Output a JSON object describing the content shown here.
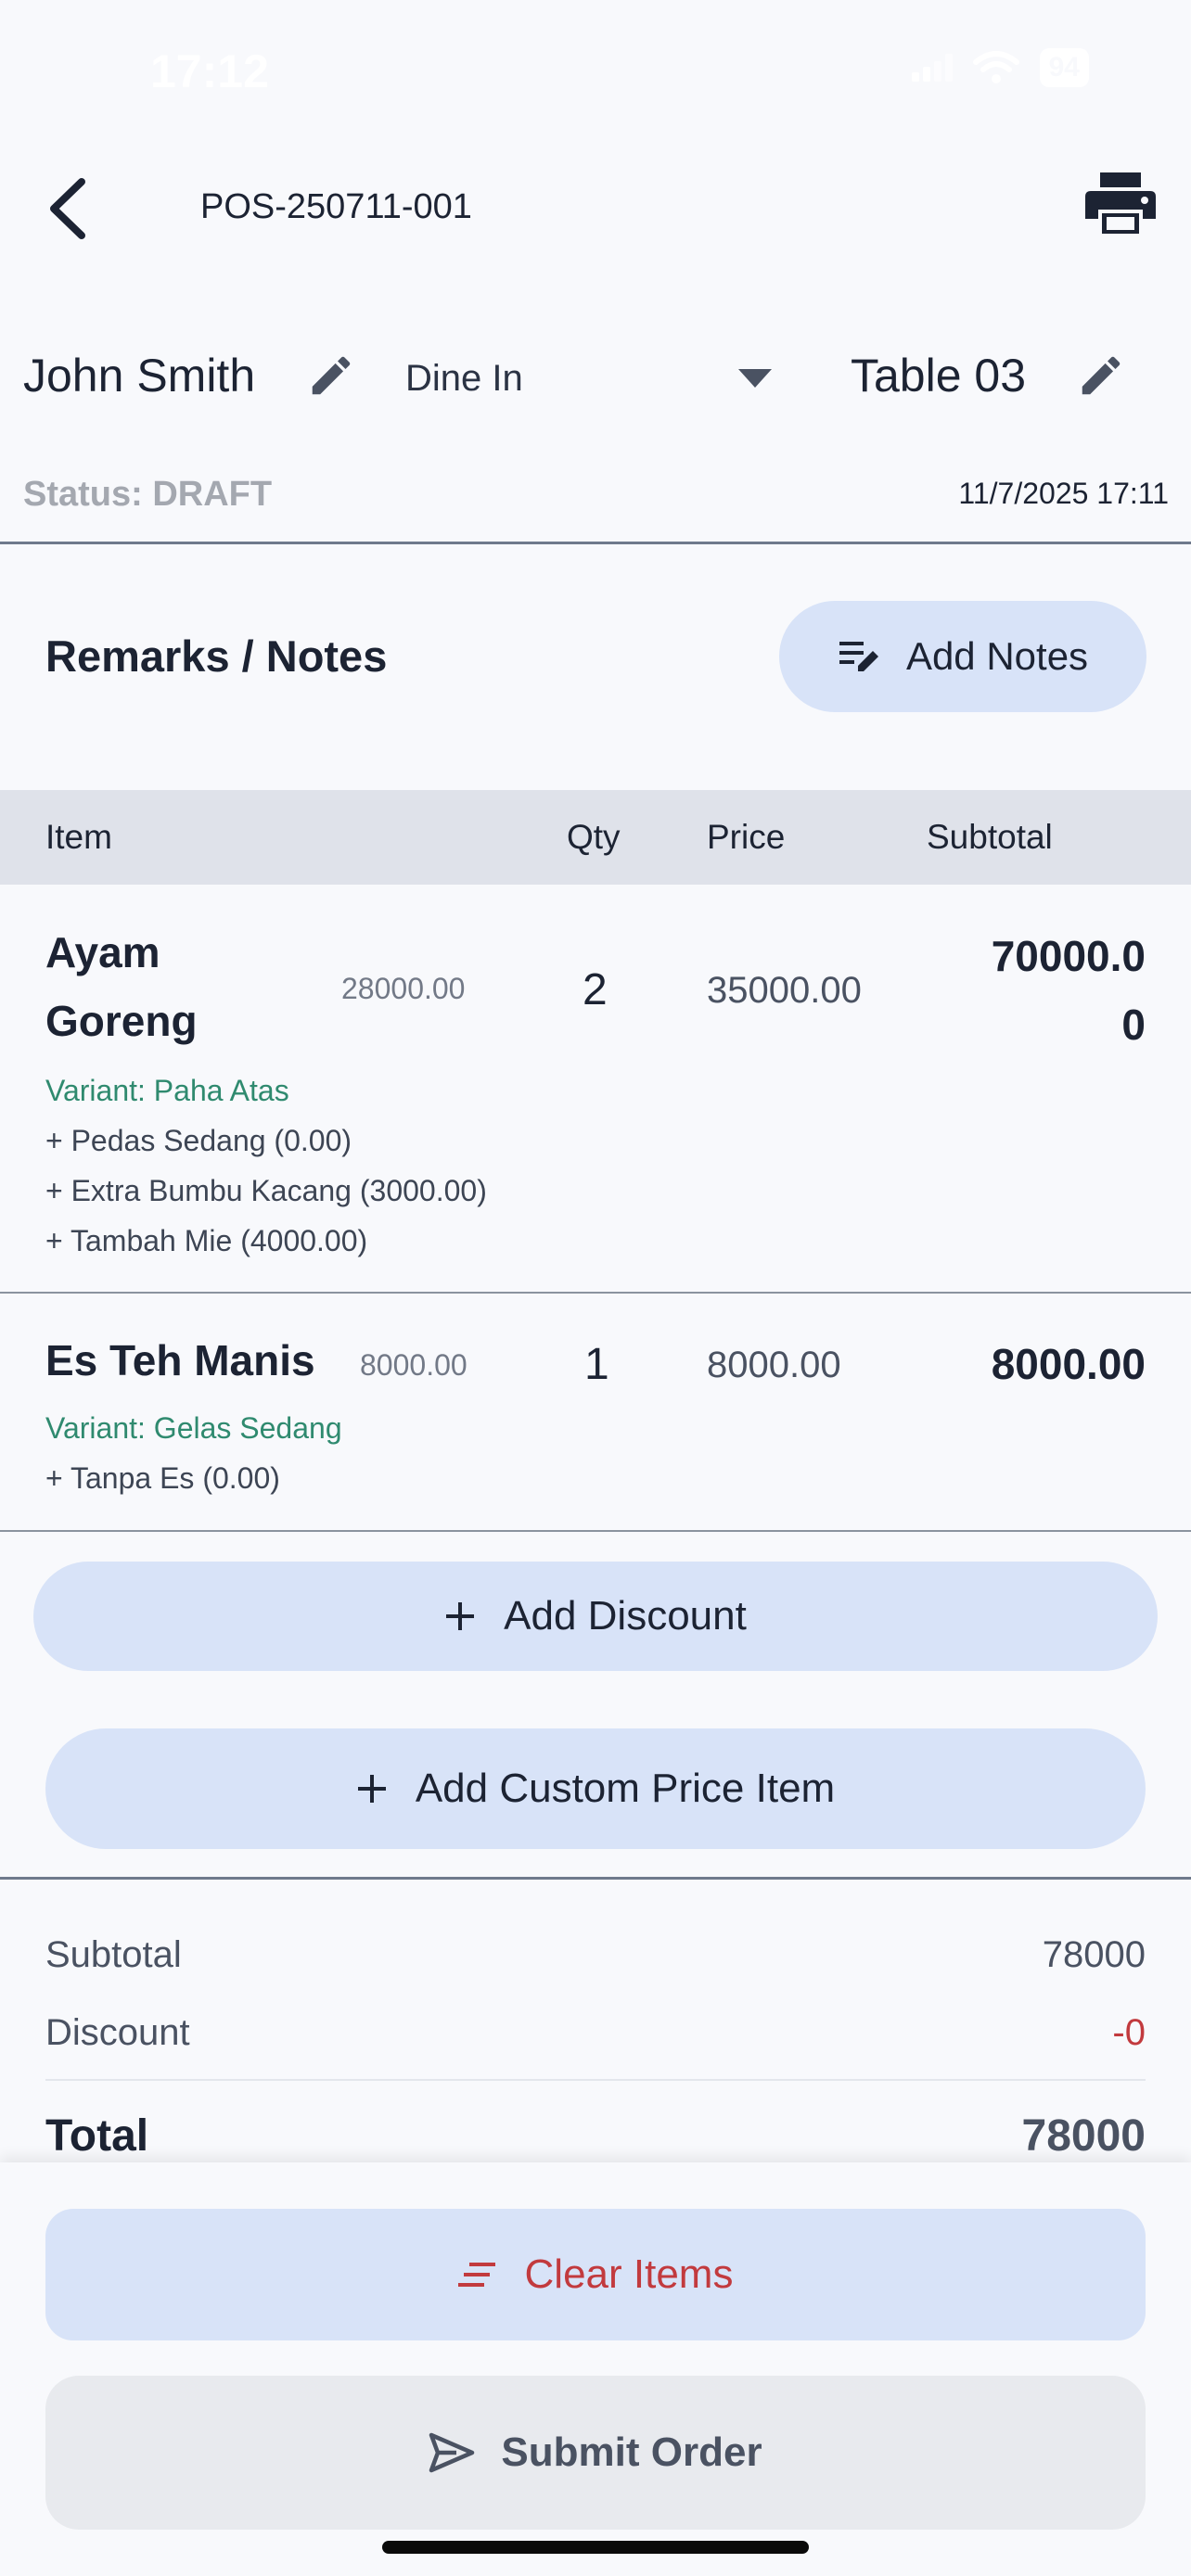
{
  "status_bar": {
    "time": "17:12",
    "battery": "94"
  },
  "header": {
    "order_id": "POS-250711-001"
  },
  "order": {
    "customer_name": "John Smith",
    "order_type": "Dine In",
    "table": "Table 03",
    "status": "Status: DRAFT",
    "datetime": "11/7/2025 17:11"
  },
  "notes": {
    "title": "Remarks / Notes",
    "button_label": "Add Notes"
  },
  "items_table": {
    "headers": [
      "Item",
      "Qty",
      "Price",
      "Subtotal"
    ],
    "rows": [
      {
        "name_line1": "Ayam",
        "name_line2": "Goreng",
        "base_price": "28000.00",
        "qty": "2",
        "price": "35000.00",
        "subtotal_line1": "70000.0",
        "subtotal_line2": "0",
        "variant": "Variant: Paha Atas",
        "addons": [
          "+ Pedas Sedang (0.00)",
          "+ Extra Bumbu Kacang (3000.00)",
          "+ Tambah Mie (4000.00)"
        ]
      },
      {
        "name": "Es Teh Manis",
        "base_price": "8000.00",
        "qty": "1",
        "price": "8000.00",
        "subtotal": "8000.00",
        "variant": "Variant: Gelas Sedang",
        "addons": [
          "+ Tanpa Es (0.00)"
        ]
      }
    ]
  },
  "actions": {
    "add_discount": "Add Discount",
    "add_custom": "Add Custom Price Item"
  },
  "totals": {
    "subtotal_label": "Subtotal",
    "subtotal_value": "78000",
    "discount_label": "Discount",
    "discount_value": "-0",
    "total_label": "Total",
    "total_value": "78000"
  },
  "footer": {
    "clear_label": "Clear Items",
    "submit_label": "Submit Order"
  },
  "colors": {
    "accent_bg": "#d8e3f8",
    "danger": "#c23a3e",
    "variant_green": "#2f8a6f"
  }
}
